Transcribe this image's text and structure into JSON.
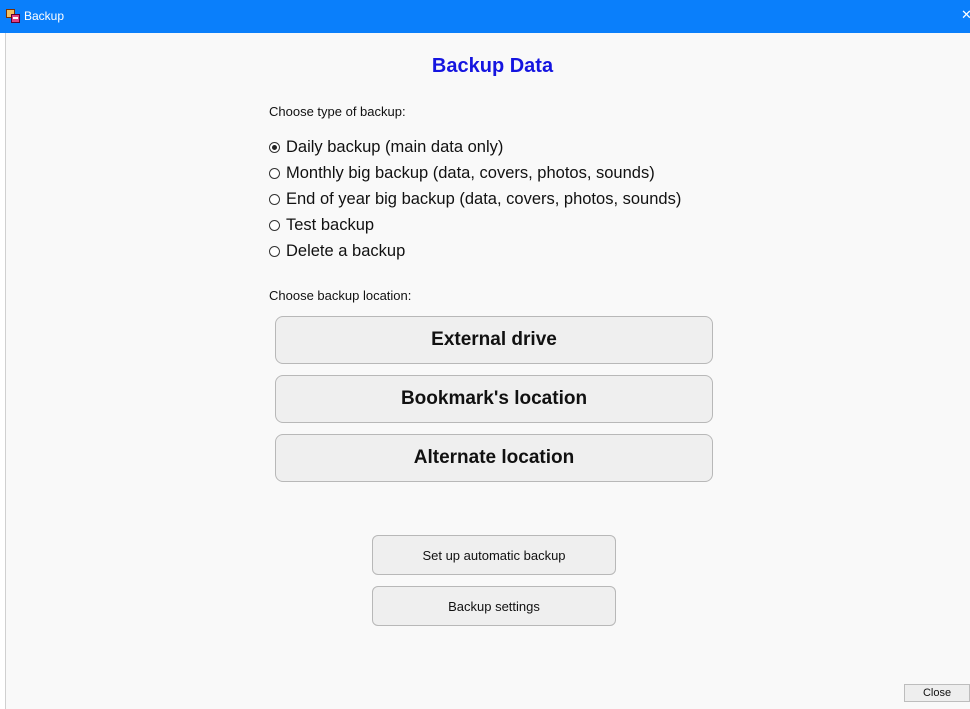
{
  "window": {
    "title": "Backup",
    "app_icon": "backup-app-icon",
    "close_glyph": "✕"
  },
  "heading": "Backup Data",
  "backup_type": {
    "label": "Choose type of backup:",
    "options": [
      {
        "label": "Daily backup (main data only)",
        "checked": true
      },
      {
        "label": "Monthly big backup (data, covers, photos, sounds)",
        "checked": false
      },
      {
        "label": "End of year big backup (data, covers, photos, sounds)",
        "checked": false
      },
      {
        "label": "Test backup",
        "checked": false
      },
      {
        "label": "Delete a backup",
        "checked": false
      }
    ]
  },
  "backup_location": {
    "label": "Choose backup location:",
    "buttons": [
      "External drive",
      "Bookmark's location",
      "Alternate location"
    ]
  },
  "actions": {
    "auto_backup": "Set up automatic backup",
    "settings": "Backup settings"
  },
  "close_button": "Close",
  "colors": {
    "titlebar": "#0a7ffb",
    "heading": "#1515e0"
  }
}
